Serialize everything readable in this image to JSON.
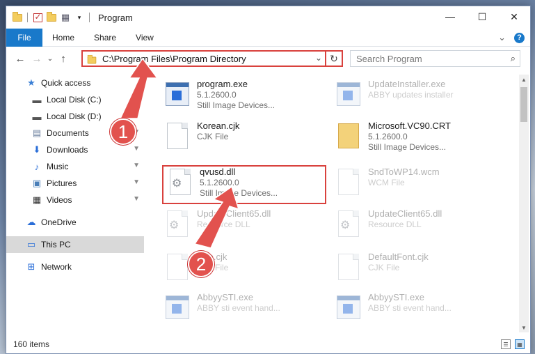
{
  "window": {
    "title": "Program",
    "controls": {
      "minimize": "—",
      "maximize": "☐",
      "close": "✕"
    }
  },
  "ribbon": {
    "tabs": [
      "File",
      "Home",
      "Share",
      "View"
    ],
    "expand_glyph": "⌄",
    "help_glyph": "?"
  },
  "nav": {
    "back": "←",
    "forward": "→",
    "recent": "⌄",
    "up": "↑",
    "address": "C:\\Program Files\\Program Directory",
    "address_chevron": "⌄",
    "refresh": "↻",
    "search_placeholder": "Search Program",
    "search_icon": "⌕"
  },
  "sidebar": {
    "items": [
      {
        "label": "Quick access",
        "icon": "star-icon",
        "glyph": "★",
        "color": "#3a7fd5",
        "pinned": false
      },
      {
        "label": "Local Disk (C:)",
        "icon": "drive-icon",
        "glyph": "▬",
        "color": "#555",
        "pinned": true
      },
      {
        "label": "Local Disk (D:)",
        "icon": "drive-icon",
        "glyph": "▬",
        "color": "#555",
        "pinned": true
      },
      {
        "label": "Documents",
        "icon": "documents-icon",
        "glyph": "▤",
        "color": "#6b7f9e",
        "pinned": true
      },
      {
        "label": "Downloads",
        "icon": "download-icon",
        "glyph": "⬇",
        "color": "#2a6ed8",
        "pinned": true
      },
      {
        "label": "Music",
        "icon": "music-icon",
        "glyph": "♪",
        "color": "#2a6ed8",
        "pinned": true
      },
      {
        "label": "Pictures",
        "icon": "pictures-icon",
        "glyph": "▣",
        "color": "#4a7fb8",
        "pinned": true
      },
      {
        "label": "Videos",
        "icon": "video-icon",
        "glyph": "▦",
        "color": "#333",
        "pinned": true
      },
      {
        "label": "OneDrive",
        "icon": "cloud-icon",
        "glyph": "☁",
        "color": "#2a6ed8",
        "pinned": false
      },
      {
        "label": "This PC",
        "icon": "computer-icon",
        "glyph": "▭",
        "color": "#2a6ed8",
        "pinned": false
      },
      {
        "label": "Network",
        "icon": "network-icon",
        "glyph": "⊞",
        "color": "#2a6ed8",
        "pinned": false
      }
    ],
    "pin_glyph": "📌"
  },
  "files": [
    {
      "name": "program.exe",
      "line2": "5.1.2600.0",
      "line3": "Still Image Devices...",
      "kind": "exe"
    },
    {
      "name": "UpdateInstaller.exe",
      "line2": "ABBY updates installer",
      "line3": "",
      "kind": "exe"
    },
    {
      "name": "Korean.cjk",
      "line2": "CJK File",
      "line3": "",
      "kind": "doc"
    },
    {
      "name": "Microsoft.VC90.CRT",
      "line2": "5.1.2600.0",
      "line3": "Still Image Devices...",
      "kind": "folder"
    },
    {
      "name": "qvusd.dll",
      "line2": "5.1.2600.0",
      "line3": "Still Image Devices...",
      "kind": "dll"
    },
    {
      "name": "SndToWP14.wcm",
      "line2": "WCM File",
      "line3": "",
      "kind": "doc"
    },
    {
      "name": "UpdateClient65.dll",
      "line2": "Resource DLL",
      "line3": "",
      "kind": "dll"
    },
    {
      "name": "UpdateClient65.dll",
      "line2": "Resource DLL",
      "line3": "",
      "kind": "dll"
    },
    {
      "name": "Lisp.cjk",
      "line2": "CJK File",
      "line3": "",
      "kind": "doc"
    },
    {
      "name": "DefaultFont.cjk",
      "line2": "CJK File",
      "line3": "",
      "kind": "doc"
    },
    {
      "name": "AbbyySTI.exe",
      "line2": "ABBY sti event hand...",
      "line3": "",
      "kind": "exe"
    },
    {
      "name": "AbbyySTI.exe",
      "line2": "ABBY sti event hand...",
      "line3": "",
      "kind": "exe"
    }
  ],
  "callouts": [
    "1",
    "2"
  ],
  "status": {
    "count": "160 items"
  },
  "colors": {
    "accent": "#1979ca",
    "highlight": "#d9413d",
    "callout": "#e2524e"
  }
}
